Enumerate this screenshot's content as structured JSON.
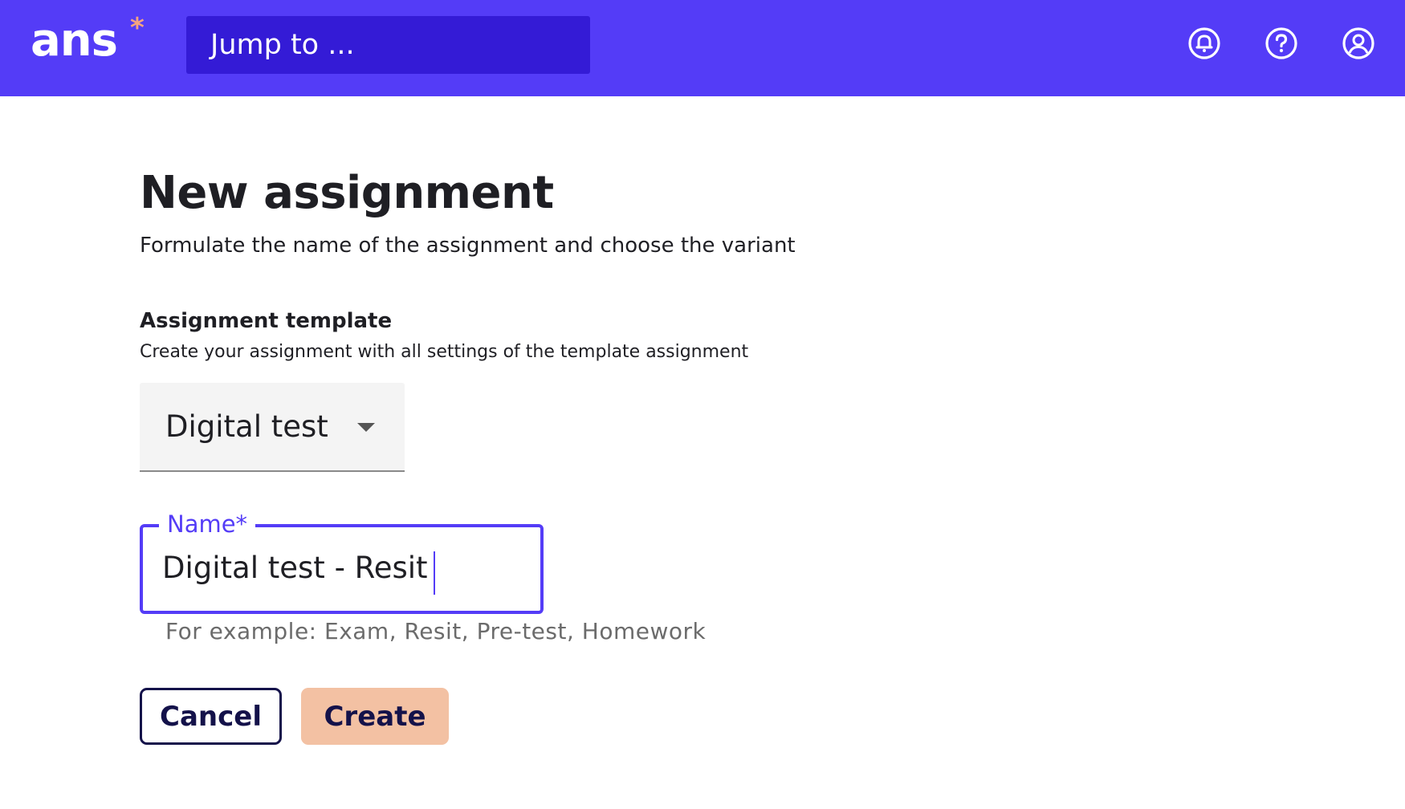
{
  "header": {
    "logo_text": "ans",
    "logo_mark": "*",
    "search_placeholder": "Jump to ...",
    "icons": [
      "bell-icon",
      "help-icon",
      "user-icon"
    ]
  },
  "page": {
    "title": "New assignment",
    "subtitle": "Formulate the name of the assignment and choose the variant"
  },
  "template_section": {
    "label": "Assignment template",
    "help": "Create your assignment with all settings of the template assignment",
    "selected": "Digital test"
  },
  "name_field": {
    "label": "Name*",
    "value": "Digital test - Resit",
    "helper": "For example: Exam, Resit, Pre-test, Homework"
  },
  "actions": {
    "cancel_label": "Cancel",
    "create_label": "Create"
  },
  "colors": {
    "brand": "#543cf7",
    "brand_dark": "#341bd6",
    "accent": "#f6a57f",
    "create_button": "#f3c1a3",
    "button_text": "#14124a"
  }
}
